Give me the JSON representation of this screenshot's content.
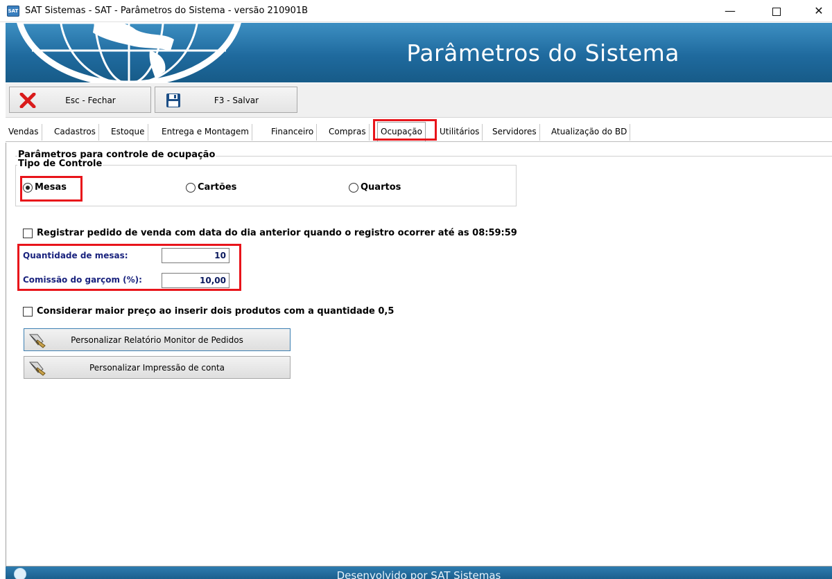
{
  "window": {
    "icon_text": "SAT",
    "title": "SAT Sistemas - SAT - Parâmetros do Sistema - versão 210901B",
    "minimize": "—",
    "close": "✕"
  },
  "banner": {
    "title": "Parâmetros do Sistema"
  },
  "toolbar": {
    "close_label": "Esc - Fechar",
    "save_label": "F3 - Salvar"
  },
  "tabs": [
    {
      "label": "Vendas"
    },
    {
      "label": "Cadastros"
    },
    {
      "label": "Estoque"
    },
    {
      "label": "Entrega e Montagem"
    },
    {
      "label": "Financeiro"
    },
    {
      "label": "Compras"
    },
    {
      "label": "Ocupação",
      "active": true
    },
    {
      "label": "Utilitários"
    },
    {
      "label": "Servidores"
    },
    {
      "label": "Atualização do BD"
    }
  ],
  "content": {
    "group_title": "Parâmetros para controle de ocupação",
    "control_type_title": "Tipo de Controle",
    "radios": [
      {
        "label": "Mesas",
        "selected": true
      },
      {
        "label": "Cartões",
        "selected": false
      },
      {
        "label": "Quartos",
        "selected": false
      }
    ],
    "check_registrar": {
      "label": "Registrar pedido de venda com data do dia anterior quando o  registro ocorrer até as 08:59:59",
      "checked": false
    },
    "quantidade_mesas": {
      "label": "Quantidade de mesas:",
      "value": "10"
    },
    "comissao_garcom": {
      "label": "Comissão do garçom (%):",
      "value": "10,00"
    },
    "check_considerar": {
      "label": "Considerar maior preço ao inserir dois produtos com a quantidade 0,5",
      "checked": false
    },
    "btn_relatorio": "Personalizar Relatório Monitor de Pedidos",
    "btn_impressao": "Personalizar Impressão de conta"
  },
  "footer": {
    "text": "Desenvolvido por SAT Sistemas"
  },
  "colors": {
    "highlight": "#e8141a",
    "banner": "#1f6a9e",
    "field_text": "#1a237e"
  }
}
